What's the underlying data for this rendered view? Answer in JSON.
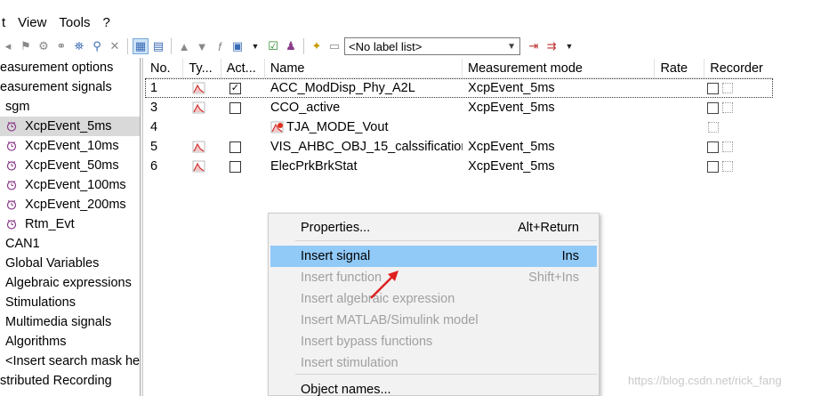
{
  "menubar": {
    "items": [
      "t",
      "View",
      "Tools",
      "?"
    ]
  },
  "toolbar": {
    "label_list_value": "<No label list>"
  },
  "tree": {
    "items": [
      {
        "label": "easurement options",
        "icon": "none",
        "indent": 0
      },
      {
        "label": "easurement signals",
        "icon": "none",
        "indent": 0
      },
      {
        "label": "sgm",
        "icon": "none",
        "indent": 1
      },
      {
        "label": "XcpEvent_5ms",
        "icon": "clock-icon",
        "indent": 2,
        "selected": true
      },
      {
        "label": "XcpEvent_10ms",
        "icon": "clock-icon",
        "indent": 2
      },
      {
        "label": "XcpEvent_50ms",
        "icon": "clock-icon",
        "indent": 2
      },
      {
        "label": "XcpEvent_100ms",
        "icon": "clock-icon",
        "indent": 2
      },
      {
        "label": "XcpEvent_200ms",
        "icon": "clock-icon",
        "indent": 2
      },
      {
        "label": "Rtm_Evt",
        "icon": "clock-icon",
        "indent": 2
      },
      {
        "label": "CAN1",
        "icon": "none",
        "indent": 1
      },
      {
        "label": "Global Variables",
        "icon": "none",
        "indent": 1
      },
      {
        "label": "Algebraic expressions",
        "icon": "none",
        "indent": 1
      },
      {
        "label": "Stimulations",
        "icon": "none",
        "indent": 1
      },
      {
        "label": "Multimedia signals",
        "icon": "none",
        "indent": 1
      },
      {
        "label": "Algorithms",
        "icon": "none",
        "indent": 1
      },
      {
        "label": "<Insert search mask he",
        "icon": "none",
        "indent": 1
      },
      {
        "label": "stributed Recording",
        "icon": "none",
        "indent": 0
      }
    ]
  },
  "table": {
    "columns": [
      "No.",
      "Ty...",
      "Act...",
      "Name",
      "Measurement mode",
      "Rate",
      "Recorder"
    ],
    "rows": [
      {
        "no": "1",
        "active": "checked",
        "name": "ACC_ModDisp_Phy_A2L",
        "mode": "XcpEvent_5ms",
        "focused": true
      },
      {
        "no": "3",
        "active": "unchecked",
        "name": "CCO_active",
        "mode": "XcpEvent_5ms"
      },
      {
        "no": "4",
        "active": "none",
        "name": "TJA_MODE_Vout",
        "mode": ""
      },
      {
        "no": "5",
        "active": "unchecked",
        "name": "VIS_AHBC_OBJ_15_calssification",
        "mode": "XcpEvent_5ms"
      },
      {
        "no": "6",
        "active": "unchecked",
        "name": "ElecPrkBrkStat",
        "mode": "XcpEvent_5ms"
      }
    ]
  },
  "context_menu": {
    "items": [
      {
        "label": "Properties...",
        "shortcut": "Alt+Return",
        "state": "enabled"
      },
      {
        "label": "Insert signal",
        "shortcut": "Ins",
        "state": "hover"
      },
      {
        "label": "Insert function",
        "shortcut": "Shift+Ins",
        "state": "disabled"
      },
      {
        "label": "Insert algebraic expression",
        "shortcut": "",
        "state": "disabled"
      },
      {
        "label": "Insert MATLAB/Simulink model",
        "shortcut": "",
        "state": "disabled"
      },
      {
        "label": "Insert bypass functions",
        "shortcut": "",
        "state": "disabled"
      },
      {
        "label": "Insert stimulation",
        "shortcut": "",
        "state": "disabled"
      },
      {
        "label": "Object names...",
        "shortcut": "",
        "state": "enabled"
      }
    ]
  },
  "watermark": "https://blog.csdn.net/rick_fang",
  "colors": {
    "hover": "#91c9f7",
    "selection": "#d9d9d9",
    "arrow": "#e02020"
  }
}
